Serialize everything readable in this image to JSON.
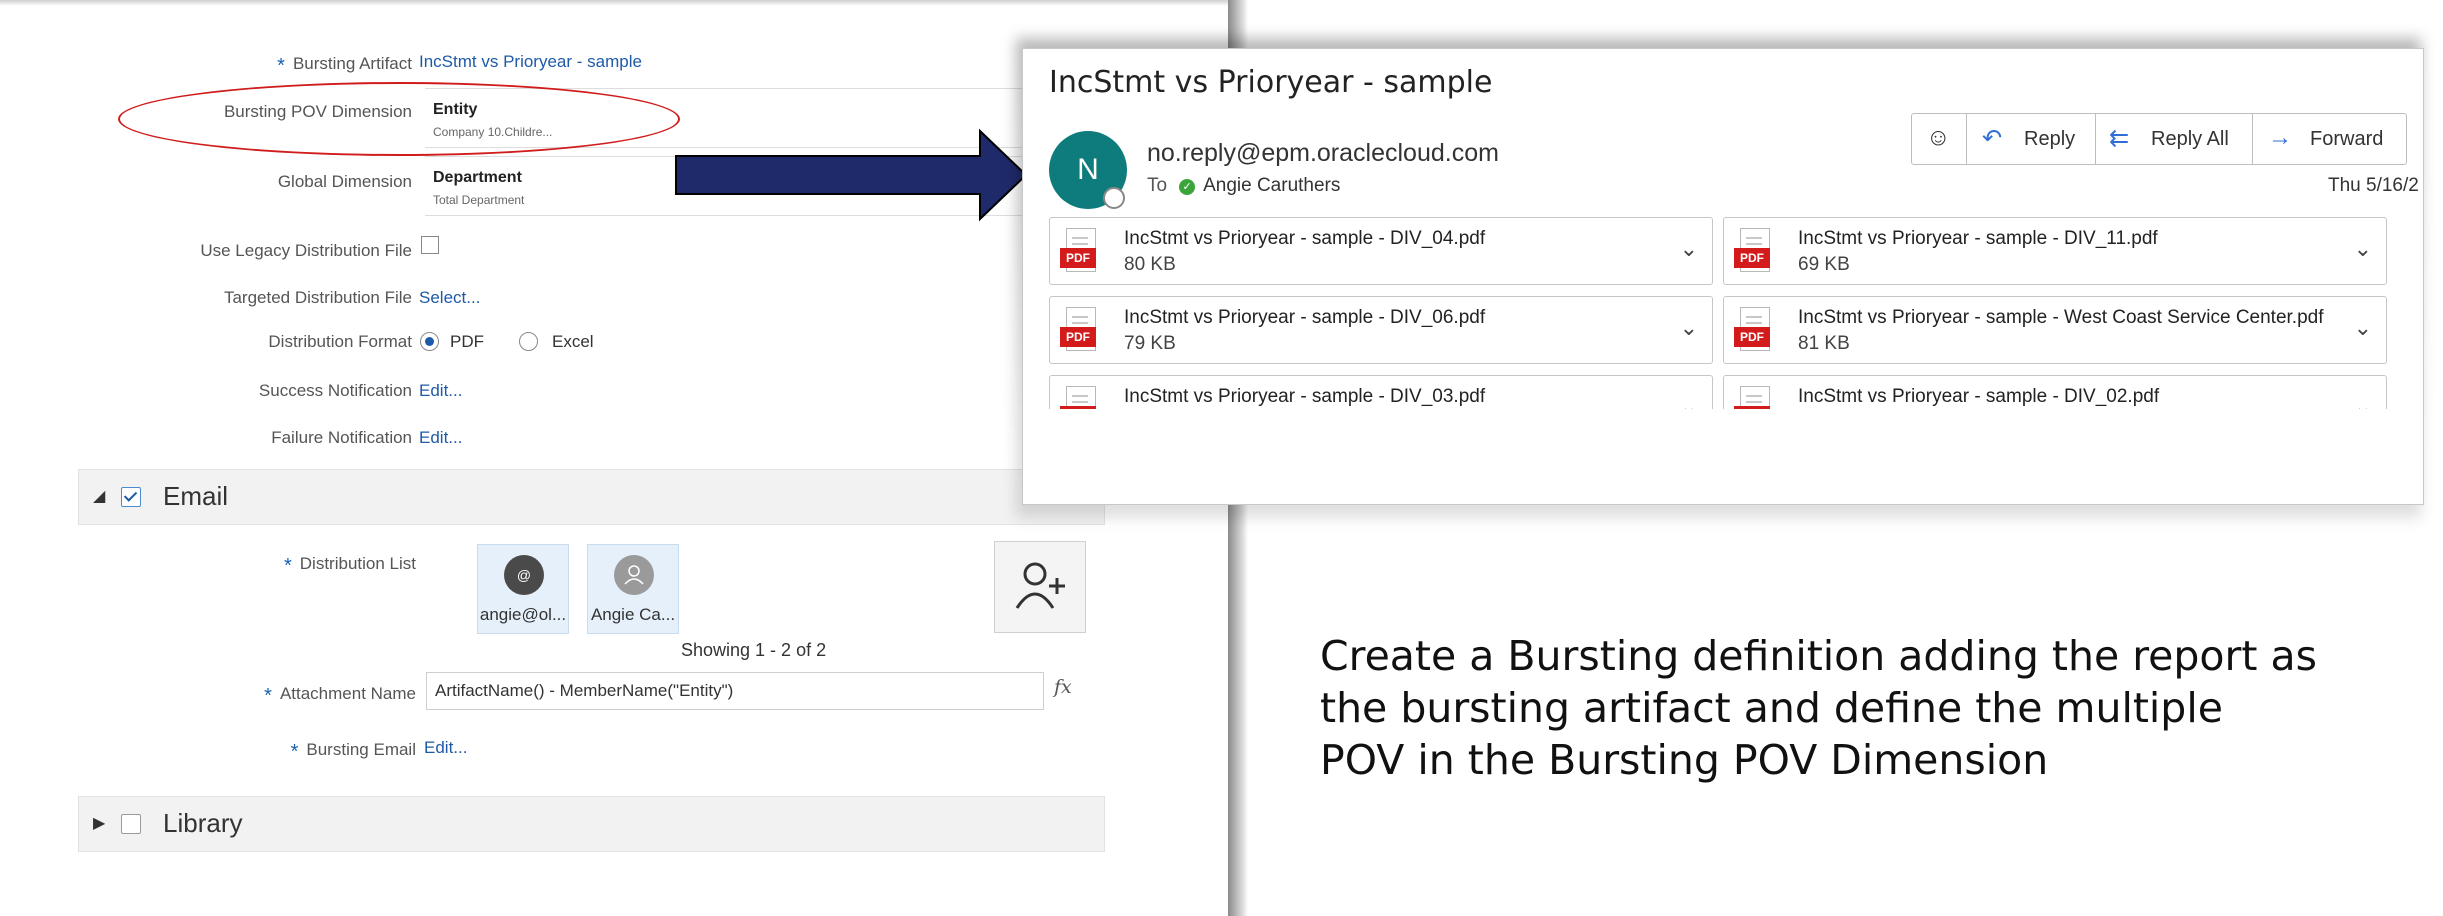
{
  "form": {
    "bursting_artifact": {
      "label": "Bursting Artifact",
      "value": "IncStmt vs Prioryear - sample"
    },
    "bursting_pov_dimension": {
      "label": "Bursting POV Dimension",
      "name": "Entity",
      "selection": "Company 10.Childre..."
    },
    "global_dimension": {
      "label": "Global Dimension",
      "name": "Department",
      "selection": "Total Department"
    },
    "use_legacy_distribution_file": {
      "label": "Use Legacy Distribution File",
      "checked": false
    },
    "targeted_distribution_file": {
      "label": "Targeted Distribution File",
      "link": "Select..."
    },
    "distribution_format": {
      "label": "Distribution Format",
      "options": [
        "PDF",
        "Excel"
      ],
      "selected": "PDF"
    },
    "success_notification": {
      "label": "Success Notification",
      "link": "Edit..."
    },
    "failure_notification": {
      "label": "Failure Notification",
      "link": "Edit..."
    }
  },
  "email_section": {
    "title": "Email",
    "checked": true,
    "distribution_list_label": "Distribution List",
    "recipients": [
      {
        "name": "angie@ol...",
        "avatar_glyph": "@",
        "color": "#4a4a4a"
      },
      {
        "name": "Angie Ca...",
        "avatar_glyph": "person-icon",
        "color": "#9a9a9a"
      }
    ],
    "showing": "Showing 1 - 2 of 2",
    "attachment_name_label": "Attachment Name",
    "attachment_name_value": "ArtifactName() - MemberName(\"Entity\")",
    "fx": "fx",
    "bursting_email_label": "Bursting Email",
    "bursting_email_link": "Edit..."
  },
  "library_section": {
    "title": "Library",
    "checked": false
  },
  "email": {
    "subject": "IncStmt vs Prioryear - sample",
    "avatar_letter": "N",
    "sender": "no.reply@epm.oraclecloud.com",
    "to_label": "To",
    "to_name": "Angie Caruthers",
    "date": "Thu 5/16/2",
    "actions": {
      "emoji": "☺",
      "reply": "Reply",
      "reply_all": "Reply All",
      "forward": "Forward"
    },
    "attachments": [
      {
        "name": "IncStmt vs Prioryear - sample - DIV_04.pdf",
        "size": "80 KB"
      },
      {
        "name": "IncStmt vs Prioryear - sample - DIV_11.pdf",
        "size": "69 KB"
      },
      {
        "name": "IncStmt vs Prioryear - sample - DIV_06.pdf",
        "size": "79 KB"
      },
      {
        "name": "IncStmt vs Prioryear - sample - West Coast Service Center.pdf",
        "size": "81 KB"
      },
      {
        "name": "IncStmt vs Prioryear - sample - DIV_03.pdf",
        "size": ""
      },
      {
        "name": "IncStmt vs Prioryear - sample - DIV_02.pdf",
        "size": ""
      }
    ],
    "pdf_badge": "PDF"
  },
  "caption": "Create a Bursting definition adding the report as the bursting artifact and define the multiple POV in the Bursting POV Dimension",
  "colors": {
    "accent": "#1e5aa8",
    "highlight_ellipse": "#d01c1c",
    "arrow": "#1f2a6b",
    "avatar_teal": "#0e7c7c",
    "pdf_red": "#d31b1b"
  }
}
